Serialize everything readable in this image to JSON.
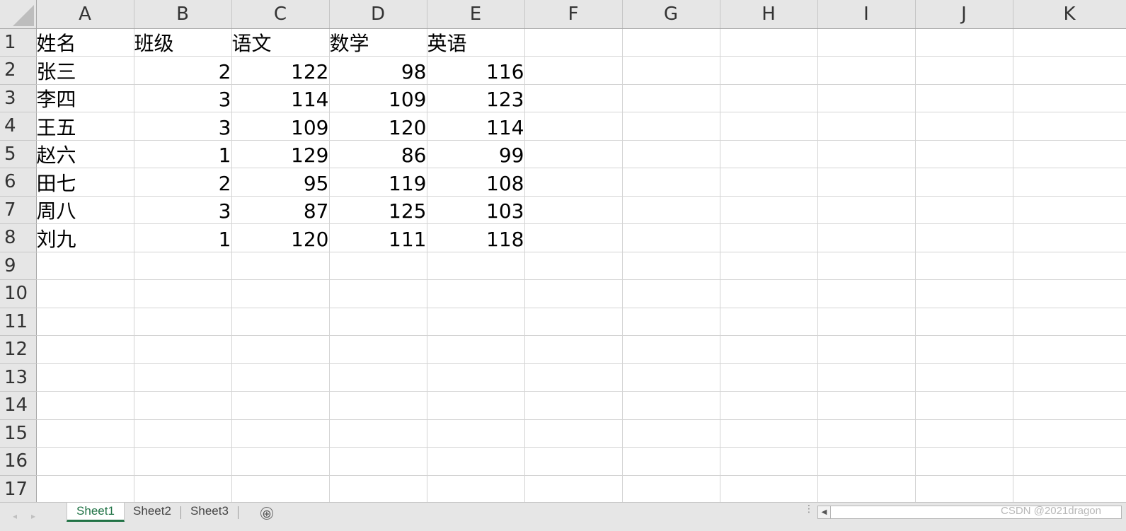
{
  "columns": [
    "A",
    "B",
    "C",
    "D",
    "E",
    "F",
    "G",
    "H",
    "I",
    "J",
    "K"
  ],
  "rows": [
    {
      "n": "1",
      "cells": [
        {
          "v": "姓名",
          "t": "txt"
        },
        {
          "v": "班级",
          "t": "txt"
        },
        {
          "v": "语文",
          "t": "txt"
        },
        {
          "v": "数学",
          "t": "txt"
        },
        {
          "v": "英语",
          "t": "txt"
        }
      ]
    },
    {
      "n": "2",
      "cells": [
        {
          "v": "张三",
          "t": "txt"
        },
        {
          "v": "2",
          "t": "num"
        },
        {
          "v": "122",
          "t": "num"
        },
        {
          "v": "98",
          "t": "num"
        },
        {
          "v": "116",
          "t": "num"
        }
      ]
    },
    {
      "n": "3",
      "cells": [
        {
          "v": "李四",
          "t": "txt"
        },
        {
          "v": "3",
          "t": "num"
        },
        {
          "v": "114",
          "t": "num"
        },
        {
          "v": "109",
          "t": "num"
        },
        {
          "v": "123",
          "t": "num"
        }
      ]
    },
    {
      "n": "4",
      "cells": [
        {
          "v": "王五",
          "t": "txt"
        },
        {
          "v": "3",
          "t": "num"
        },
        {
          "v": "109",
          "t": "num"
        },
        {
          "v": "120",
          "t": "num"
        },
        {
          "v": "114",
          "t": "num"
        }
      ]
    },
    {
      "n": "5",
      "cells": [
        {
          "v": "赵六",
          "t": "txt"
        },
        {
          "v": "1",
          "t": "num"
        },
        {
          "v": "129",
          "t": "num"
        },
        {
          "v": "86",
          "t": "num"
        },
        {
          "v": "99",
          "t": "num"
        }
      ]
    },
    {
      "n": "6",
      "cells": [
        {
          "v": "田七",
          "t": "txt"
        },
        {
          "v": "2",
          "t": "num"
        },
        {
          "v": "95",
          "t": "num"
        },
        {
          "v": "119",
          "t": "num"
        },
        {
          "v": "108",
          "t": "num"
        }
      ]
    },
    {
      "n": "7",
      "cells": [
        {
          "v": "周八",
          "t": "txt"
        },
        {
          "v": "3",
          "t": "num"
        },
        {
          "v": "87",
          "t": "num"
        },
        {
          "v": "125",
          "t": "num"
        },
        {
          "v": "103",
          "t": "num"
        }
      ]
    },
    {
      "n": "8",
      "cells": [
        {
          "v": "刘九",
          "t": "txt"
        },
        {
          "v": "1",
          "t": "num"
        },
        {
          "v": "120",
          "t": "num"
        },
        {
          "v": "111",
          "t": "num"
        },
        {
          "v": "118",
          "t": "num"
        }
      ]
    },
    {
      "n": "9",
      "cells": []
    },
    {
      "n": "10",
      "cells": []
    },
    {
      "n": "11",
      "cells": []
    },
    {
      "n": "12",
      "cells": []
    },
    {
      "n": "13",
      "cells": []
    },
    {
      "n": "14",
      "cells": []
    },
    {
      "n": "15",
      "cells": []
    },
    {
      "n": "16",
      "cells": []
    },
    {
      "n": "17",
      "cells": []
    }
  ],
  "sheets": [
    {
      "label": "Sheet1",
      "active": true
    },
    {
      "label": "Sheet2",
      "active": false
    },
    {
      "label": "Sheet3",
      "active": false
    }
  ],
  "tabbar": {
    "add_icon": "⊕",
    "nav_prev_icon": "triangle-left-icon",
    "nav_next_icon": "triangle-right-icon",
    "scroll_left_icon": "◀"
  },
  "watermark": "CSDN @2021dragon",
  "colors": {
    "accent": "#217346",
    "header_bg": "#e6e6e6",
    "gridline": "#d4d4d4"
  }
}
